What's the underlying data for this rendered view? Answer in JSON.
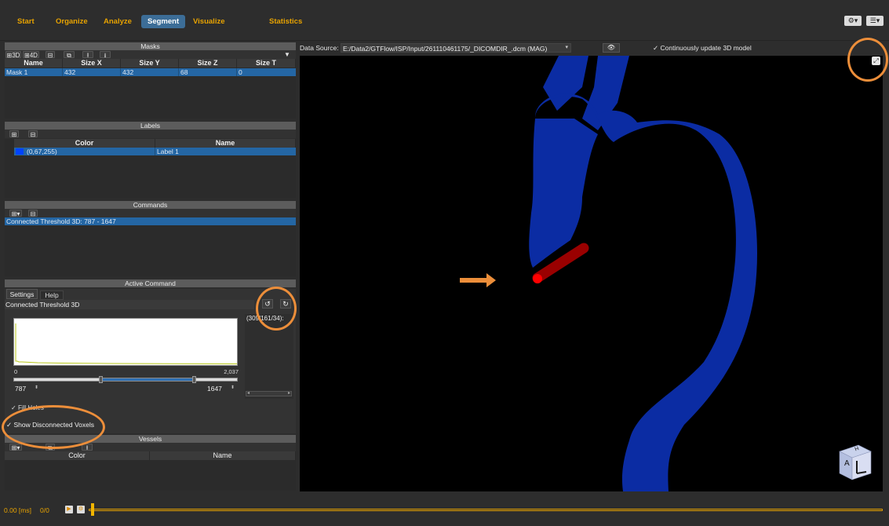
{
  "menu": {
    "tabs": [
      {
        "label": "Start"
      },
      {
        "label": "Organize"
      },
      {
        "label": "Analyze"
      },
      {
        "label": "Segment"
      },
      {
        "label": "Visualize"
      },
      {
        "label": "Statistics"
      }
    ],
    "active_tab": "Segment"
  },
  "masks": {
    "title": "Masks",
    "toolbar": {
      "btn_3d": "3D",
      "btn_4d": "4D"
    },
    "columns": [
      "Name",
      "Size X",
      "Size Y",
      "Size Z",
      "Size T"
    ],
    "rows": [
      {
        "name": "Mask 1",
        "size_x": "432",
        "size_y": "432",
        "size_z": "68",
        "size_t": "0"
      }
    ]
  },
  "labels": {
    "title": "Labels",
    "columns": [
      "Color",
      "Name"
    ],
    "rows": [
      {
        "color_text": "(0,67,255)",
        "swatch": "#0043ff",
        "name": "Label 1"
      }
    ]
  },
  "commands": {
    "title": "Commands",
    "items": [
      "Connected Threshold 3D: 787 - 1647"
    ]
  },
  "active_command": {
    "title": "Active Command",
    "tabs": [
      "Settings",
      "Help"
    ],
    "command_name": "Connected Threshold 3D",
    "histogram_min": "0",
    "histogram_max": "2,037",
    "range_low": "787",
    "range_high": "1647",
    "seed_text": "(309/161/34):",
    "fill_holes_label": "Fill Holes",
    "show_disconnected_label": "Show Disconnected Voxels",
    "show_disconnected_checked": true
  },
  "vessels": {
    "title": "Vessels",
    "columns": [
      "Color",
      "Name"
    ]
  },
  "viewport": {
    "data_source_label": "Data Source:",
    "data_source_value": "E:/Data2/GTFlow/ISP/Input/261110461175/_DICOMDIR_.dcm (MAG)",
    "continuous_update_label": "Continuously update 3D model",
    "continuous_update_checked": true,
    "orientation_cube_letters": [
      "H",
      "A"
    ],
    "vessel_color": "#0b2ca3",
    "seed_color": "#d40000"
  },
  "timeline": {
    "time_text": "0.00 [ms]",
    "frame_text": "0/0"
  },
  "colors": {
    "accent_orange": "#e8a300",
    "active_tab_bg": "#3c6d97",
    "selection_blue": "#2466a4",
    "annotation_orange": "#ec8e3a"
  }
}
